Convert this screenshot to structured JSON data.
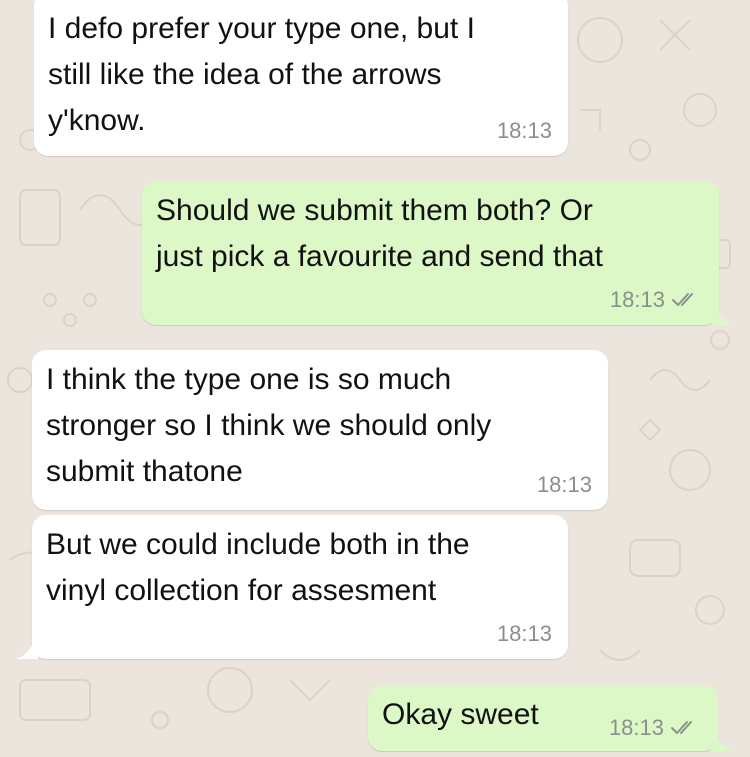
{
  "messages": [
    {
      "direction": "incoming",
      "text": "I defo prefer your type one, but I\nstill like the idea of the arrows\ny'know.",
      "time": "18:13",
      "status_icon": null
    },
    {
      "direction": "outgoing",
      "text": "Should we submit them both? Or\njust pick a favourite and send that",
      "time": "18:13",
      "status_icon": "double-check-icon"
    },
    {
      "direction": "incoming",
      "text": "I think the type one is so much\nstronger so I think we should only\nsubmit thatone",
      "time": "18:13",
      "status_icon": null
    },
    {
      "direction": "incoming",
      "text": "But we could include both in the\nvinyl collection for assesment",
      "time": "18:13",
      "status_icon": null
    },
    {
      "direction": "outgoing",
      "text": "Okay sweet",
      "time": "18:13",
      "status_icon": "double-check-icon"
    }
  ],
  "colors": {
    "chat_background": "#ece5dd",
    "incoming_bubble": "#ffffff",
    "outgoing_bubble": "#dcf8c6",
    "timestamp": "#8b8f8c",
    "ticks": "#8b8f8c"
  }
}
